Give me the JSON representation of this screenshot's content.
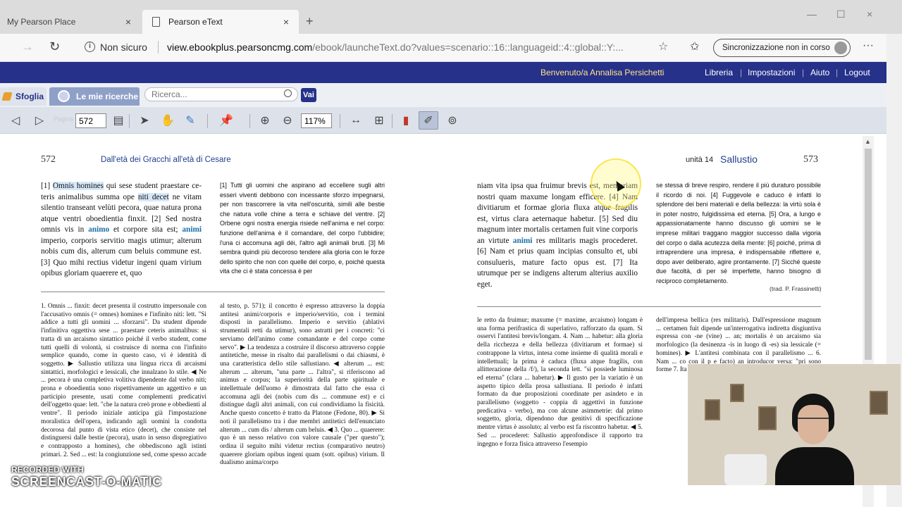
{
  "browser": {
    "tabs": [
      {
        "title": "My Pearson Place",
        "active": false
      },
      {
        "title": "Pearson eText",
        "active": true
      }
    ],
    "security_label": "Non sicuro",
    "url_host": "view.ebookplus.pearsoncmg.com",
    "url_path": "/ebook/launcheText.do?values=scenario::16::languageid::4::global::Y:...",
    "sync_label": "Sincronizzazione non in corso",
    "new_tab": "+",
    "close_glyph": "×",
    "menu_glyph": "···"
  },
  "site_header": {
    "welcome": "Benvenuto/a  Annalisa Persichetti",
    "nav": [
      "Libreria",
      "Impostazioni",
      "Aiuto",
      "Logout"
    ]
  },
  "toolbar": {
    "tab_sfoglia": "Sfoglia",
    "tab_ricerche": "Le mie ricerche",
    "search_placeholder": "Ricerca...",
    "vai_label": "Vai",
    "pagina_label": "Pagina",
    "page_value": "572",
    "zoom_value": "117%"
  },
  "book": {
    "left_page": {
      "number": "572",
      "running_head": "Dall'età dei Gracchi all'età di Cesare",
      "latin_html": "[1] <span class='hl-blue'>Omnis homines</span> qui sese student praestare ce&shy;teris animalibus summa ope <span class='hl-blue'>niti decet</span> ne vitam silentio transeant velùti pecora, quae natura pro&shy;na atque ventri oboedientia finxit. [2] Sed nostra omnis vis in <span class='kw'>animo</span> et corpore sita est; <span class='kw'>animi</span> imperio, corporis servitio magis utimur; alte&shy;rum nobis cum dis, alterum cum beluis com&shy;mune est. [3] Quo mihi rectius videtur ingeni quam virium opibus gloriam quaerere et, quo&shy;",
      "translation": "[1] Tutti gli uomini che aspirano ad eccellere sugli altri esseri viventi debbono con incessante sforzo impegnar&shy;si, per non trascorrere la vita nell'oscurità, simili alle be&shy;stie che natura volle chine a terra e schiave del ventre. [2] Orbene ogni nostra energia risiede nell'anima e nel corpo: funzione dell'anima è il comandare, del corpo l'ubbidire; l'una ci accomuna agli dèi, l'altro agli animali bruti. [3] Mi sembra quindi più decoroso tendere alla gloria con le forze dello spirito che non con quelle del corpo, e, poiché questa vita che ci è stata concessa è per",
      "notes_col1": "1. Omnis ... finxit: decet presenta il costrutto imper&shy;sonale con l'accusativo omnis (= omnes) homines e l'in&shy;finito niti: lett. \"Si addice a tutti gli uomini ... sforzarsi\". Da student dipende l'infinitiva oggettiva sese ... praesta&shy;re ceteris animalibus: si tratta di un arcaismo sintattico poiché il verbo student, come tutti quelli di volontà, si costruisce di norma con l'infinito semplice quando, co&shy;me in questo caso, vi è identità di soggetto. ▶ Sallustio utilizza una lingua ricca di arcaismi sintattici, morfolo&shy;gici e lessicali, che innalzano lo stile. ◀ Ne ... pecora è una completiva volitiva dipendente dal verbo niti; prona e oboedientia sono rispettivamente un aggettivo e un par&shy;ticipio presente, usati come complementi predicativi dell'oggetto quae: lett. \"che la natura creò prone e obbe&shy;dienti al ventre\". Il periodo iniziale anticipa già l'impo&shy;stazione moralistica dell'opera, indicando agli uomini la condotta decorosa dal punto di vista etico (decet), che consiste nel distinguersi dalle bestie (pecora), usato in senso dispregiativo e contrapposto a homines), che obbe&shy;discono agli istinti primari. 2. Sed ... est: la congiunzione sed, come spesso accade",
      "notes_col2": "al testo, p. 571); il concetto è espresso attraverso la dop&shy;pia antitesi animi/corporis e imperio/servitio, con i ter&shy;mini disposti in parallelismo. Imperio e servitio (ablati&shy;vi strumentali retti da utimur), sono astratti per i concreti: \"ci serviamo dell'animo come comandante e del corpo come servo\". ▶ La tendenza a costruire il di&shy;scorso attraverso coppie antitetiche, messe in risalto dai parallelismi o dai chiasmi, è una caratteristica dello stile sallustiano. ◀ alterum ... est: alterum ... alterum, \"una parte ... l'altra\", si riferiscono ad animus e corpus; la su&shy;periorità della parte spirituale e intellettuale dell'uomo è dimostrata dal fatto che essa ci accomuna agli dei (no&shy;bis cum dis ... commune est) e ci distingue dagli altri ani&shy;mali, con cui condividiamo la fisicità. Anche questo concetto è tratto da Platone (Fedone, 80). ▶ Si noti il pa&shy;rallelismo tra i due membri antitetici dell'enunciato al&shy;terum ... cum dis / alterum cum beluis. ◀ 3. Quo ... quaerere: quo è un nesso relativo con valore causale (\"per questo\"); ordina il seguito mihi videtur rectius (comparativo neutro) quaerere gloriam opibus in&shy;geni quam (sott. opibus) virium. Il dualismo anima/corpo"
    },
    "right_page": {
      "number": "573",
      "unit_label": "unità 14",
      "unit_name": "Sallustio",
      "latin_html": "niam vita ipsa qua fruimur brevis est, memo&shy;riam nostri quam maxume longam efficere. [4] Nam divitiarum et formae gloria fluxa atque fragilis est, virtus clara aeternaque habetur. [5] Sed diu magnum inter mortalis certamen fuit vine corporis an virtute <span class='kw'>animi</span> res militaris ma&shy;gis procederet. [6] Nam et prius quam incipias consulto et, ubi consulueris, mature facto opus est. [7] Ita utrumque per se indigens alterum al&shy;terius auxilio eget.",
      "translation": "se stessa di breve respiro, rendere il più duraturo possi&shy;bile il ricordo di noi. [4] Fuggevole e caduco è infatti lo splendore dei beni materiali e della bellezza: la virtù so&shy;la è in poter nostro, fulgidissima ed eterna. [5] Ora, a lungo e appassionatamente hanno discusso gli uomini se le imprese militari traggano maggior successo dalla vigoria del corpo o dalla acutezza della mente: [6] poiché, prima di intraprendere una impresa, è indi&shy;spensabile riflettere e, dopo aver deliberato, agire pron&shy;tamente. [7] Sicché queste due facoltà, di per sé imper&shy;fette, hanno bisogno di reciproco completamento.",
      "attribution": "(trad. P. Frassinetti)",
      "notes_col1": "le retto da fruimur; maxume (= maxime, arcaismo) lon&shy;gam è una forma perifrastica di superlativo, rafforzato da quam. Si osservi l'antitesi brevis/longam. 4. Nam ... habetur: alla gloria della ricchezza e della bellezza (divitiarum et formae) si contrappone la virtus, intesa come insieme di qualità morali e intellettuali; la prima è caduca (fluxa atque fragilis, con allitterazione della /f/), la seconda lett. \"si possiede luminosa ed eterna\" (clara ... habetur). ▶ Il gusto per la variatio è un aspetto ti&shy;pico della prosa sallustiana. Il periodo è infatti formato da due proposizioni coordinate per asindeto e in parallelismo (soggetto - coppia di aggettivi in funzione predicativa - verbo), ma con alcune asimmetrie: dal primo soggetto, gloria, dipendono due genitivi di specificazione mentre virtus è assoluto; al verbo est fa riscontro habetur. ◀ 5. Sed ... procederet: Sallustio approfondisce il rap&shy;porto tra ingegno e forza fisica attraverso l'esempio",
      "notes_col2": "dell'impresa bellica (res militaris). Dall'espressione mag&shy;num ... certamen fuit dipende un'interrogativa indiretta disgiuntiva espressa con -ne (vine) ... an; mortalis è un arcaismo sia morfologico (la desinenza -is in luogo di -es) sia lessicale (= homines). ▶ L'antitesi combinata con il parallelismo ... 6. Nam ... co con il p e facto) an introducor versa: \"pri sono forme 7. Ita ... mento; il animi) eg ris) sono d"
    }
  },
  "overlay": {
    "watermark_line1": "RECORDED WITH",
    "watermark_line2": "SCREENCAST-O-MATIC"
  },
  "colors": {
    "header_bg": "#26318a",
    "welcome_text": "#ffe58a",
    "keyword": "#1a6fa8",
    "running_head": "#1f3f8c",
    "highlight": "#d6e8f8"
  }
}
